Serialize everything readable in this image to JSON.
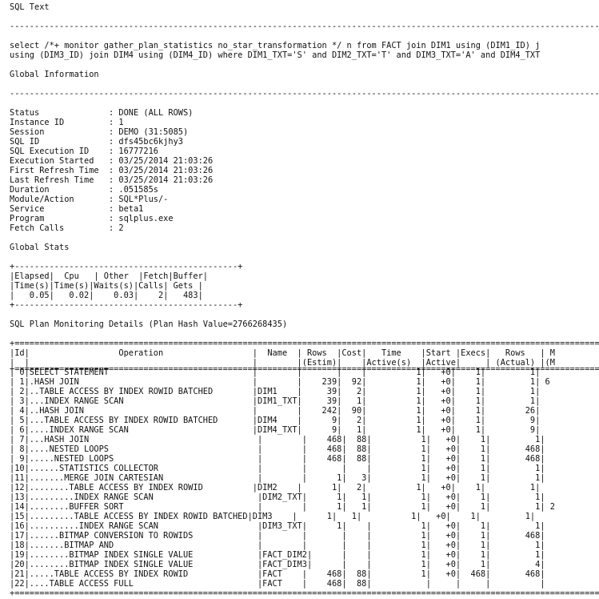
{
  "report": {
    "sql_text_header": "SQL Text",
    "dash_sep": "------------------------------------------------------------------------------------------------------------------------------------",
    "sql_line_1": "select /*+ monitor gather_plan_statistics no_star_transformation */ n from FACT join DIM1 using (DIM1_ID) j",
    "sql_line_2": "using (DIM3_ID) join DIM4 using (DIM4_ID) where DIM1_TXT='S' and DIM2_TXT='T' and DIM3_TXT='A' and DIM4_TXT",
    "global_info_header": "Global Information",
    "info_rows": [
      "Status              : DONE (ALL ROWS)",
      "Instance ID         : 1",
      "Session             : DEMO (31:5085)",
      "SQL ID              : dfs45bc6kjhy3",
      "SQL Execution ID    : 16777216",
      "Execution Started   : 03/25/2014 21:03:26",
      "First Refresh Time  : 03/25/2014 21:03:26",
      "Last Refresh Time   : 03/25/2014 21:03:26",
      "Duration            : .051585s",
      "Module/Action       : SQL*Plus/-",
      "Service             : beta1",
      "Program             : sqlplus.exe",
      "Fetch Calls         : 2"
    ],
    "global_stats_header": "Global Stats",
    "stats_rows": [
      "+---------------------------------------------+",
      "|Elapsed|  Cpu   | Other  |Fetch|Buffer|",
      "|Time(s)|Time(s)|Waits(s)|Calls| Gets |",
      "|   0.05|   0.02|    0.03|    2|   483|",
      "+---------------------------------------------+"
    ],
    "plan_header": "SQL Plan Monitoring Details (Plan Hash Value=2766268435)",
    "plan_top_border": "+================================================================================================================================",
    "plan_head_1": "|Id|                  Operation                  |  Name  | Rows  |Cost|   Time    |Start |Execs|   Rows   | M",
    "plan_head_2": "|  |                                             |        |(Estim)|    |Active(s)  |Active|     | (Actual) |(M",
    "plan_rule": "+==================================================================================================================================",
    "plan_rows": [
      "| 0|SELECT STATEMENT                             |        |       |    |          1|   +0|    1|         1|",
      "| 1|.HASH JOIN                                   |        |    239|  92|          1|   +0|    1|         1| 6",
      "| 2|..TABLE ACCESS BY INDEX ROWID BATCHED        |DIM1    |     39|   2|          1|   +0|    1|         1|",
      "| 3|...INDEX RANGE SCAN                          |DIM1_TXT|     39|   1|          1|   +0|    1|         1|",
      "| 4|..HASH JOIN                                  |        |    242|  90|          1|   +0|    1|        26|",
      "| 5|...TABLE ACCESS BY INDEX ROWID BATCHED       |DIM4    |      9|   2|          1|   +0|    1|         9|",
      "| 6|....INDEX RANGE SCAN                         |DIM4_TXT|      9|   1|          1|   +0|    1|         9|",
      "| 7|...HASH JOIN                                  |        |    468|  88|          1|   +0|    1|         1|",
      "| 8|....NESTED LOOPS                              |        |    468|  88|          1|   +0|    1|       468|",
      "| 9|.....NESTED LOOPS                             |        |    468|  88|          1|   +0|    1|       468|",
      "|10|......STATISTICS COLLECTOR                    |        |       |    |          1|   +0|    1|         1|",
      "|11|.......MERGE JOIN CARTESIAN                   |        |      1|   3|          1|   +0|    1|         1|",
      "|12|........TABLE ACCESS BY INDEX ROWID          |DIM2    |      1|   2|          1|   +0|    1|         1|",
      "|13|.........INDEX RANGE SCAN                     |DIM2_TXT|      1|   1|          1|   +0|    1|         1|",
      "|14|........BUFFER SORT                           |        |      1|   1|          1|   +0|    1|         1| 2",
      "|15|.........TABLE ACCESS BY INDEX ROWID BATCHED|DIM3    |      1|   1|          1|   +0|    1|         1|",
      "|16|..........INDEX RANGE SCAN                    |DIM3_TXT|      1|    |          1|   +0|    1|         1|",
      "|17|......BITMAP CONVERSION TO ROWIDS             |        |       |    |          1|   +0|    1|       468|",
      "|18|.......BITMAP AND                             |        |       |    |          1|   +0|    1|         1|",
      "|19|........BITMAP INDEX SINGLE VALUE             |FACT_DIM2|      |    |          1|   +0|    1|         1|",
      "|20|........BITMAP INDEX SINGLE VALUE             |FACT_DIM3|      |    |          1|   +0|    1|         4|",
      "|21|.....TABLE ACCESS BY INDEX ROWID              |FACT    |    468|  88|          1|   +0|  468|       468|",
      "|22|....TABLE ACCESS FULL                         |FACT    |    468|  88|           |     |     |          |"
    ],
    "plan_bottom_border": "+================================================================================================================================"
  }
}
